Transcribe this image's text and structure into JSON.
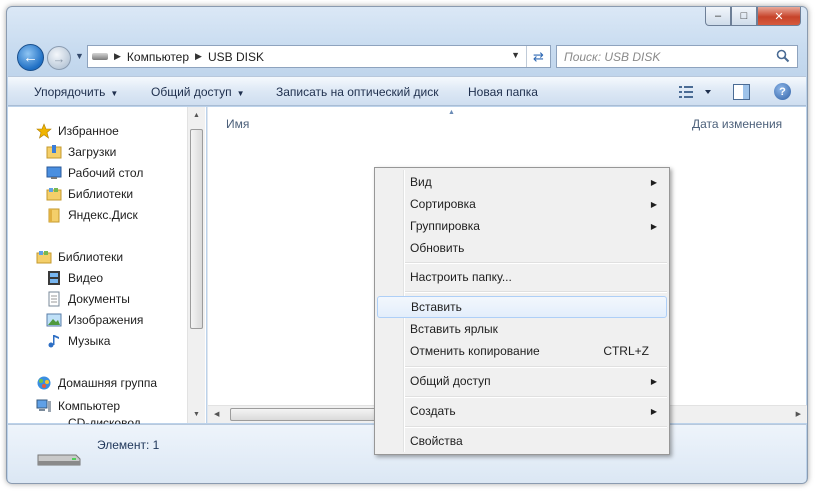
{
  "address": {
    "crumbs": [
      "Компьютер",
      "USB DISK"
    ],
    "search_placeholder": "Поиск: USB DISK"
  },
  "toolbar": {
    "organize": "Упорядочить",
    "share": "Общий доступ",
    "burn": "Записать на оптический диск",
    "new_folder": "Новая папка"
  },
  "nav_pane": {
    "favorites": "Избранное",
    "favorites_items": [
      "Загрузки",
      "Рабочий стол",
      "Библиотеки",
      "Яндекс.Диск"
    ],
    "libraries": "Библиотеки",
    "libraries_items": [
      "Видео",
      "Документы",
      "Изображения",
      "Музыка"
    ],
    "homegroup": "Домашняя группа",
    "computer": "Компьютер",
    "computer_items": [
      "CD-дисковод"
    ]
  },
  "content": {
    "col_name": "Имя",
    "col_date": "Дата изменения"
  },
  "details": {
    "text": "Элемент: 1"
  },
  "context_menu": {
    "items": [
      {
        "label": "Вид",
        "submenu": true
      },
      {
        "label": "Сортировка",
        "submenu": true
      },
      {
        "label": "Группировка",
        "submenu": true
      },
      {
        "label": "Обновить"
      },
      {
        "label": "Настроить папку..."
      },
      {
        "label": "Вставить",
        "highlighted": true
      },
      {
        "label": "Вставить ярлык"
      },
      {
        "label": "Отменить копирование",
        "shortcut": "CTRL+Z"
      },
      {
        "label": "Общий доступ",
        "submenu": true
      },
      {
        "label": "Создать",
        "submenu": true
      },
      {
        "label": "Свойства"
      }
    ]
  },
  "colors": {
    "accent": "#2e6fc4",
    "menu_highlight": "#e3eefb",
    "window_frame": "#c9dcf0"
  }
}
